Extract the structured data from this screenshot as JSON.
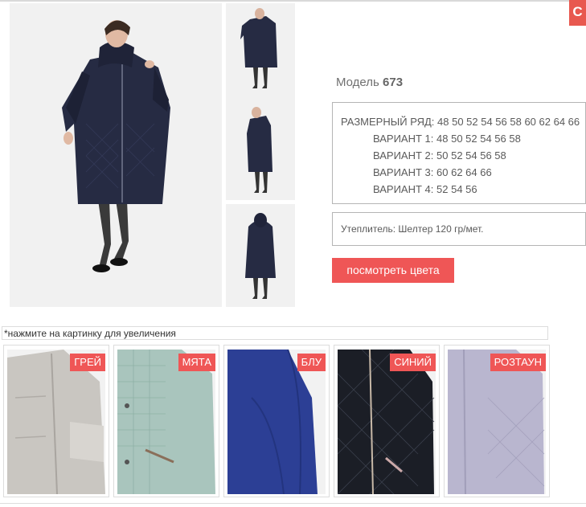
{
  "close_button": {
    "label": "С"
  },
  "gallery": {
    "main_image": "model-673-front-photo",
    "thumbnails": [
      "thumbnail-front",
      "thumbnail-side",
      "thumbnail-back"
    ]
  },
  "model": {
    "prefix": "Модель",
    "number": "673"
  },
  "sizes": {
    "range_label": "РАЗМЕРНЫЙ РЯД:",
    "range_values": "48 50 52 54 56 58 60 62 64 66",
    "variants": [
      {
        "label": "ВАРИАНТ 1:",
        "values": "48 50 52 54 56 58"
      },
      {
        "label": "ВАРИАНТ 2:",
        "values": "50 52 54 56 58"
      },
      {
        "label": "ВАРИАНТ 3:",
        "values": "60 62 64 66"
      },
      {
        "label": "ВАРИАНТ 4:",
        "values": "52 54 56"
      }
    ]
  },
  "insulation": "Утеплитель: Шелтер 120 гр/мет.",
  "view_colors_button": "посмотреть цвета",
  "hint": "*нажмите на картинку для увеличения",
  "swatches": [
    {
      "label": "ГРЕЙ",
      "color": "#c9c6c1"
    },
    {
      "label": "МЯТА",
      "color": "#a9c5bd"
    },
    {
      "label": "БЛУ",
      "color": "#2c3f95"
    },
    {
      "label": "СИНИЙ",
      "color": "#1b1e26"
    },
    {
      "label": "РОЗТАУН",
      "color": "#b9b6cf"
    }
  ],
  "colors": {
    "accent": "#ef5656",
    "coat_navy": "#262b43"
  }
}
